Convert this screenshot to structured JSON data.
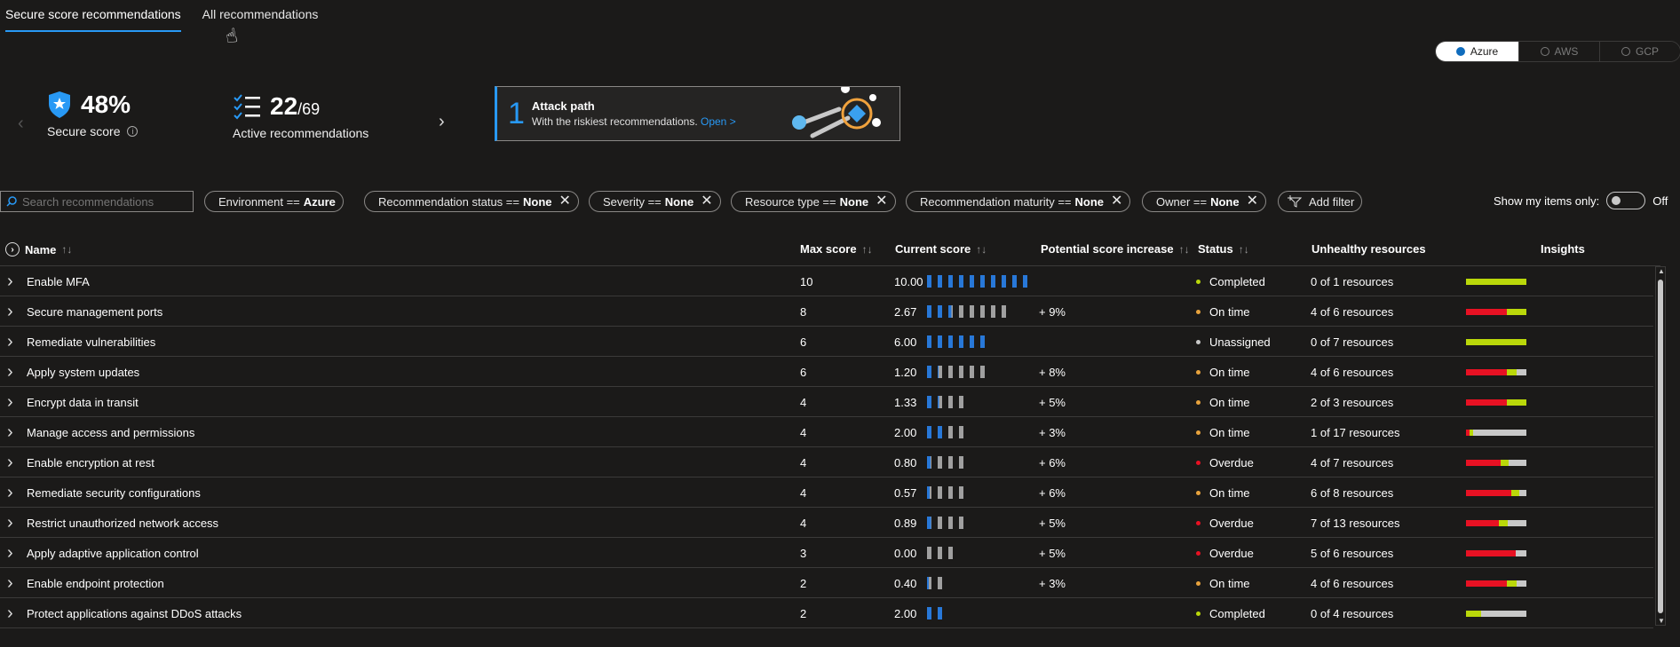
{
  "tabs": [
    "Secure score recommendations",
    "All recommendations"
  ],
  "clouds": [
    {
      "label": "Azure",
      "selected": true
    },
    {
      "label": "AWS",
      "selected": false
    },
    {
      "label": "GCP",
      "selected": false
    }
  ],
  "summary": {
    "secure_score_value": "48%",
    "secure_score_label": "Secure score",
    "active_value": "22",
    "active_total": "/69",
    "active_label": "Active recommendations"
  },
  "attack_path": {
    "count": "1",
    "title": "Attack path",
    "subtitle": "With the riskiest recommendations.",
    "link": "Open >"
  },
  "search": {
    "placeholder": "Search recommendations"
  },
  "filters": [
    {
      "key": "Environment ==",
      "value": "Azure",
      "removable": false
    },
    {
      "key": "Recommendation status ==",
      "value": "None",
      "removable": true
    },
    {
      "key": "Severity ==",
      "value": "None",
      "removable": true
    },
    {
      "key": "Resource type ==",
      "value": "None",
      "removable": true
    },
    {
      "key": "Recommendation maturity ==",
      "value": "None",
      "removable": true
    },
    {
      "key": "Owner ==",
      "value": "None",
      "removable": true
    }
  ],
  "add_filter_label": "Add filter",
  "show_my_items": {
    "label": "Show my items only:",
    "state": "Off"
  },
  "columns": {
    "name": "Name",
    "max_score": "Max score",
    "current_score": "Current score",
    "potential": "Potential score increase",
    "status": "Status",
    "unhealthy": "Unhealthy resources",
    "insights": "Insights"
  },
  "status_colors": {
    "Completed": "#bad80a",
    "On time": "#e8a33d",
    "Unassigned": "#c8c8c8",
    "Overdue": "#e81123"
  },
  "bar_colors": {
    "unhealthy": "#e81123",
    "healthy": "#bad80a",
    "na": "#c8c8c8"
  },
  "rows": [
    {
      "name": "Enable MFA",
      "max": "10",
      "current": "10.00",
      "segments": 10,
      "filled": 10,
      "potential": "",
      "status": "Completed",
      "unhealthy": "0 of 1 resources",
      "insight": [
        0,
        1,
        0
      ]
    },
    {
      "name": "Secure management ports",
      "max": "8",
      "current": "2.67",
      "segments": 8,
      "filled": 2.67,
      "potential": "+ 9%",
      "status": "On time",
      "unhealthy": "4 of 6 resources",
      "insight": [
        0.67,
        0.33,
        0
      ]
    },
    {
      "name": "Remediate vulnerabilities",
      "max": "6",
      "current": "6.00",
      "segments": 6,
      "filled": 6,
      "potential": "",
      "status": "Unassigned",
      "unhealthy": "0 of 7 resources",
      "insight": [
        0,
        1,
        0
      ]
    },
    {
      "name": "Apply system updates",
      "max": "6",
      "current": "1.20",
      "segments": 6,
      "filled": 1.2,
      "potential": "+ 8%",
      "status": "On time",
      "unhealthy": "4 of 6 resources",
      "insight": [
        0.67,
        0.17,
        0.16
      ]
    },
    {
      "name": "Encrypt data in transit",
      "max": "4",
      "current": "1.33",
      "segments": 4,
      "filled": 1.33,
      "potential": "+ 5%",
      "status": "On time",
      "unhealthy": "2 of 3 resources",
      "insight": [
        0.67,
        0.33,
        0
      ]
    },
    {
      "name": "Manage access and permissions",
      "max": "4",
      "current": "2.00",
      "segments": 4,
      "filled": 2,
      "potential": "+ 3%",
      "status": "On time",
      "unhealthy": "1 of 17 resources",
      "insight": [
        0.06,
        0.06,
        0.88
      ]
    },
    {
      "name": "Enable encryption at rest",
      "max": "4",
      "current": "0.80",
      "segments": 4,
      "filled": 0.8,
      "potential": "+ 6%",
      "status": "Overdue",
      "unhealthy": "4 of 7 resources",
      "insight": [
        0.57,
        0.14,
        0.29
      ]
    },
    {
      "name": "Remediate security configurations",
      "max": "4",
      "current": "0.57",
      "segments": 4,
      "filled": 0.57,
      "potential": "+ 6%",
      "status": "On time",
      "unhealthy": "6 of 8 resources",
      "insight": [
        0.75,
        0.13,
        0.12
      ]
    },
    {
      "name": "Restrict unauthorized network access",
      "max": "4",
      "current": "0.89",
      "segments": 4,
      "filled": 0.89,
      "potential": "+ 5%",
      "status": "Overdue",
      "unhealthy": "7 of 13 resources",
      "insight": [
        0.54,
        0.15,
        0.31
      ]
    },
    {
      "name": "Apply adaptive application control",
      "max": "3",
      "current": "0.00",
      "segments": 3,
      "filled": 0,
      "potential": "+ 5%",
      "status": "Overdue",
      "unhealthy": "5 of 6 resources",
      "insight": [
        0.83,
        0,
        0.17
      ]
    },
    {
      "name": "Enable endpoint protection",
      "max": "2",
      "current": "0.40",
      "segments": 2,
      "filled": 0.4,
      "potential": "+ 3%",
      "status": "On time",
      "unhealthy": "4 of 6 resources",
      "insight": [
        0.67,
        0.17,
        0.16
      ]
    },
    {
      "name": "Protect applications against DDoS attacks",
      "max": "2",
      "current": "2.00",
      "segments": 2,
      "filled": 2,
      "potential": "",
      "status": "Completed",
      "unhealthy": "0 of 4 resources",
      "insight": [
        0,
        0.25,
        0.75
      ]
    }
  ]
}
